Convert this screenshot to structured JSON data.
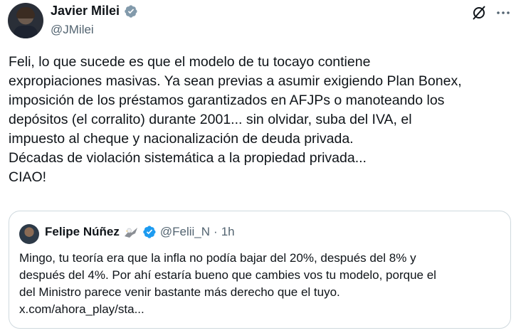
{
  "tweet": {
    "author_name": "Javier Milei",
    "author_handle": "@JMilei",
    "lines": [
      "Feli, lo que sucede es que el modelo de tu tocayo contiene",
      "expropiaciones masivas. Ya sean previas a asumir exigiendo Plan Bonex,",
      "imposición de los préstamos garantizados en AFJPs o manoteando los",
      "depósitos (el corralito) durante 2001... sin olvidar, suba del IVA, el",
      "impuesto al cheque y nacionalización de deuda privada.",
      "Décadas de violación sistemática a la propiedad privada...",
      "CIAO!"
    ]
  },
  "quote": {
    "author_name": "Felipe Núñez",
    "author_handle": "@Felii_N",
    "separator": "·",
    "time": "1h",
    "lines": [
      "Mingo, tu teoría era que la infla no podía bajar del 20%, después del 8% y",
      "después del 4%. Por ahí estaría bueno que cambies vos tu modelo, porque el",
      "del Ministro parece venir bastante más derecho que el tuyo.",
      "x.com/ahora_play/sta..."
    ]
  },
  "icons": {
    "verified": "verified-badge-icon",
    "grok": "grok-icon",
    "more": "more-icon",
    "eagle": "eagle-emoji-icon"
  },
  "colors": {
    "text": "#0f1419",
    "secondary": "#536471",
    "verified": "#1d9bf0",
    "border": "#cfd9de"
  }
}
